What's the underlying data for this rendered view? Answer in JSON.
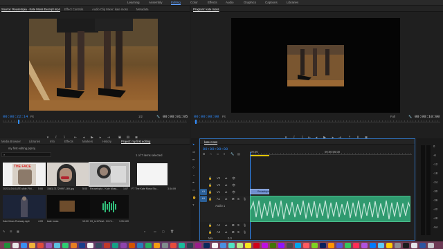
{
  "workspace_tabs": [
    "Learning",
    "Assembly",
    "Editing",
    "Color",
    "Effects",
    "Audio",
    "Graphics",
    "Captions",
    "Libraries"
  ],
  "active_workspace": "Editing",
  "source_panel": {
    "tabs": [
      "Source: Reusetopia - Kate Moss Excerpt.mp4",
      "Effect Controls",
      "Audio Clip Mixer: kate moss",
      "Metadata"
    ],
    "timecode_in": "00:00:22:14",
    "fit": "Fit",
    "scale": "1/2",
    "timecode_duration": "00:00:01:05"
  },
  "program_panel": {
    "tab": "Program: kate moss",
    "timecode_in": "00:00:00:00",
    "fit": "Fit",
    "scale": "Full",
    "timecode_duration": "00:00:10:00"
  },
  "project_panel": {
    "tabs": [
      "Media Browser",
      "Libraries",
      "Info",
      "Effects",
      "Markers",
      "History",
      "Project: my first editing"
    ],
    "project_file": "my first editing.prproj",
    "selection_info": "1 of 7 items selected",
    "items": [
      {
        "name": "20231104-KATE-slide-FIN...",
        "dur": "5:00"
      },
      {
        "name": "1581171729997-169.jpg",
        "dur": "5:00"
      },
      {
        "name": "Reusetopia - Kate Moss...",
        "dur": "1:07"
      },
      {
        "name": "FT The Kate Moss Sto...",
        "dur": "3:34:09"
      },
      {
        "name": "Kate Moss Runway.mp4",
        "dur": "4:09"
      },
      {
        "name": "kate moss",
        "dur": "10:00"
      },
      {
        "name": "03_is it Real - Chi V...",
        "dur": "1:31:120"
      }
    ]
  },
  "timeline": {
    "tab": "kate moss",
    "timecode": "00:00:00:00",
    "ruler_start": ":00:00",
    "ruler_mid": "00:00:05:00",
    "video_tracks": [
      "V3",
      "V2",
      "V1"
    ],
    "audio_tracks": [
      "A1",
      "A2",
      "A3"
    ],
    "source_patch_v": "V1",
    "source_patch_a": "A1",
    "video_clip_label": "Reusetopia",
    "audio_track_name": "Audio 1",
    "mix_label": "Mix",
    "mix_value": "0.0"
  },
  "meter_scale": [
    "0",
    "-6",
    "-12",
    "-18",
    "-24",
    "-30",
    "-36",
    "-42",
    "-48",
    "-54"
  ],
  "colors": {
    "accent": "#2f8cff",
    "video_clip": "#6f8fcf",
    "audio_clip": "#2f9a6f",
    "audio_wave": "#c6e6da"
  }
}
